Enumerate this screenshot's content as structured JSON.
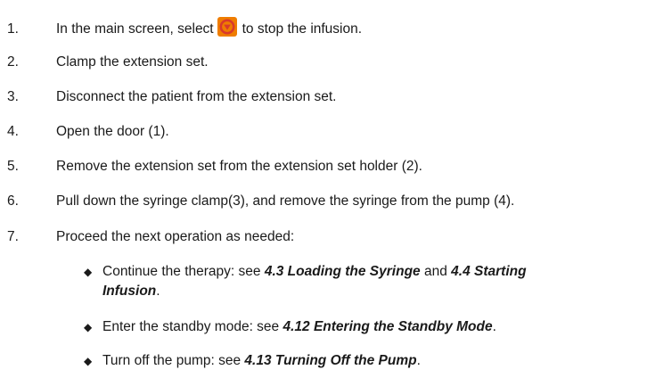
{
  "steps": [
    {
      "number": "1.",
      "before": "In the main screen, select",
      "icon": "stop-infusion-icon",
      "after": "to stop the infusion."
    },
    {
      "number": "2.",
      "text": "Clamp the extension set."
    },
    {
      "number": "3.",
      "text": "Disconnect the patient from the extension set."
    },
    {
      "number": "4.",
      "text": "Open the door (1)."
    },
    {
      "number": "5.",
      "text": "Remove the extension set from the extension set holder (2)."
    },
    {
      "number": "6.",
      "text": "Pull down the syringe clamp(3), and remove the syringe from the pump (4)."
    },
    {
      "number": "7.",
      "text": "Proceed the next operation as needed:"
    }
  ],
  "options": [
    {
      "lead": "Continue the therapy: see ",
      "ref1": "4.3 Loading the Syringe",
      "mid": " and ",
      "ref2_line1": "4.4 Starting",
      "ref2_line2": "Infusion",
      "tail": "."
    },
    {
      "lead": "Enter the standby mode: see ",
      "ref": "4.12 Entering the Standby Mode",
      "tail": "."
    },
    {
      "lead": "Turn off the pump: see ",
      "ref": "4.13 Turning Off the Pump",
      "tail": "."
    }
  ],
  "bullet_glyph": "◆",
  "colors": {
    "icon_bg": "#ef7d00",
    "icon_ring": "#d93a2b",
    "icon_glyph": "#ffffff",
    "text": "#1a1a1a"
  }
}
